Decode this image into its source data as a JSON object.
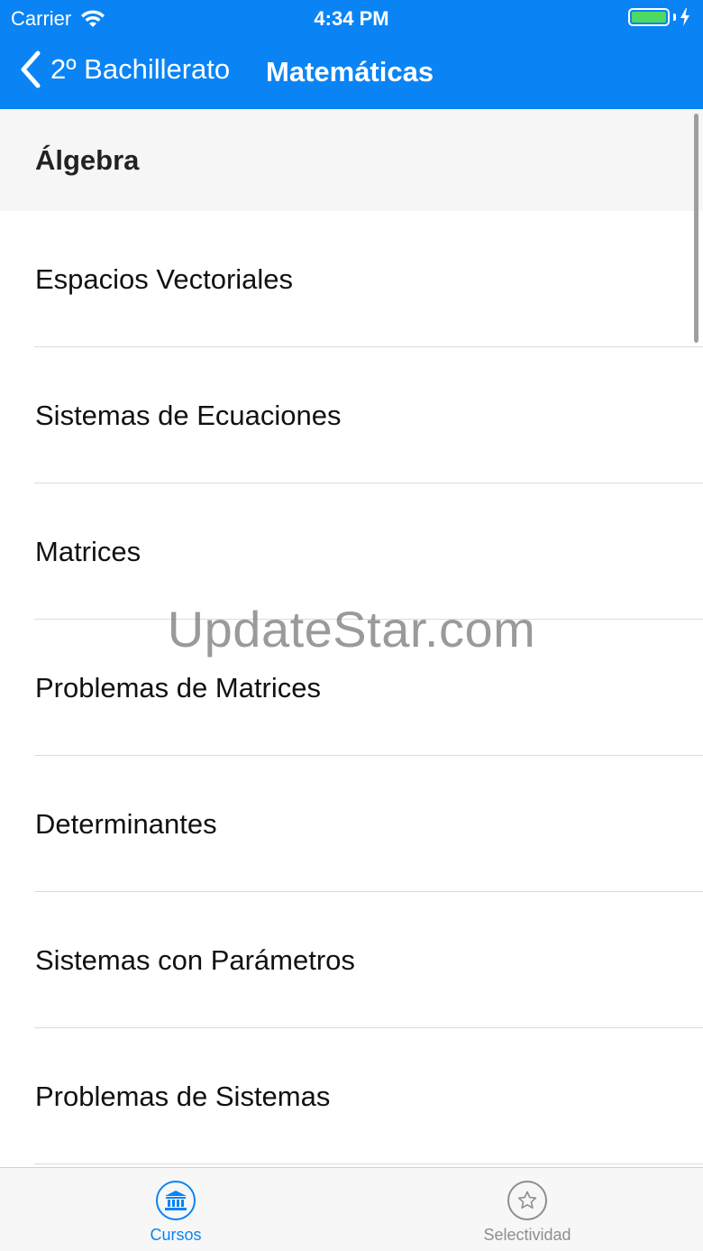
{
  "status_bar": {
    "carrier": "Carrier",
    "time": "4:34 PM"
  },
  "nav": {
    "back_label": "2º Bachillerato",
    "title": "Matemáticas"
  },
  "section": {
    "header": "Álgebra",
    "items": [
      {
        "label": "Espacios Vectoriales"
      },
      {
        "label": "Sistemas de Ecuaciones"
      },
      {
        "label": "Matrices"
      },
      {
        "label": "Problemas de Matrices"
      },
      {
        "label": "Determinantes"
      },
      {
        "label": "Sistemas con Parámetros"
      },
      {
        "label": "Problemas de Sistemas"
      }
    ]
  },
  "watermark": "UpdateStar.com",
  "tabbar": {
    "tabs": [
      {
        "label": "Cursos",
        "icon": "bank-icon",
        "selected": true
      },
      {
        "label": "Selectividad",
        "icon": "star-icon",
        "selected": false
      }
    ]
  },
  "colors": {
    "accent": "#0a84f5",
    "battery": "#4cd964",
    "inactive": "#8e8e8e"
  }
}
